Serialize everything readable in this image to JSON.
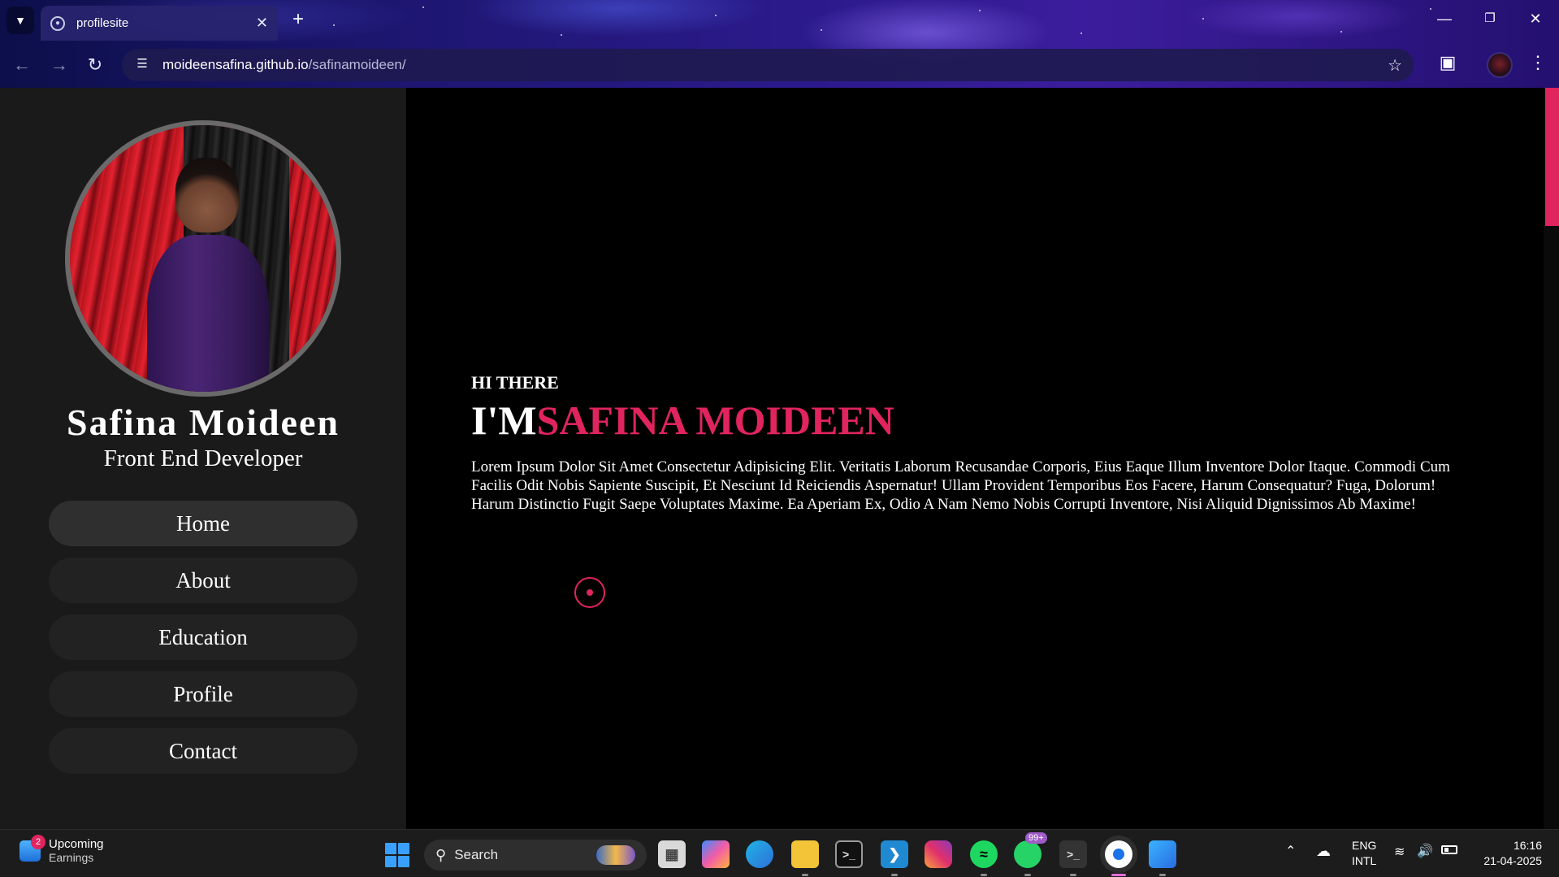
{
  "browser": {
    "tab": {
      "title": "profilesite"
    },
    "address": {
      "host": "moideensafina.github.io",
      "path": "/safinamoideen/"
    }
  },
  "sidebar": {
    "name": "Safina Moideen",
    "role": "Front End Developer",
    "nav": [
      {
        "label": "Home",
        "active": true
      },
      {
        "label": "About"
      },
      {
        "label": "Education"
      },
      {
        "label": "Profile"
      },
      {
        "label": "Contact"
      }
    ]
  },
  "hero": {
    "greeting": "HI THERE",
    "prefix": "I'M",
    "name": "SAFINA MOIDEEN",
    "intro": "Lorem Ipsum Dolor Sit Amet Consectetur Adipisicing Elit. Veritatis Laborum Recusandae Corporis, Eius Eaque Illum Inventore Dolor Itaque. Commodi Cum Facilis Odit Nobis Sapiente Suscipit, Et Nesciunt Id Reiciendis Aspernatur! Ullam Provident Temporibus Eos Facere, Harum Consequatur? Fuga, Dolorum! Harum Distinctio Fugit Saepe Voluptates Maxime. Ea Aperiam Ex, Odio A Nam Nemo Nobis Corrupti Inventore, Nisi Aliquid Dignissimos Ab Maxime!"
  },
  "taskbar": {
    "widget": {
      "badge": "2",
      "title": "Upcoming",
      "subtitle": "Earnings"
    },
    "search_label": "Search",
    "whatsapp_badge": "99+",
    "language": {
      "line1": "ENG",
      "line2": "INTL"
    },
    "clock": {
      "time": "16:16",
      "date": "21-04-2025"
    }
  },
  "colors": {
    "accent": "#e0245e",
    "sidebar_bg": "#1a1a1a",
    "main_bg": "#000000"
  },
  "icons": {
    "tab_favicon": "globe-icon",
    "back": "arrow-left-icon",
    "forward": "arrow-right-icon",
    "reload": "reload-icon",
    "site_info": "tune-icon",
    "bookmark": "star-icon",
    "extensions": "puzzle-icon",
    "menu": "kebab-menu-icon"
  }
}
